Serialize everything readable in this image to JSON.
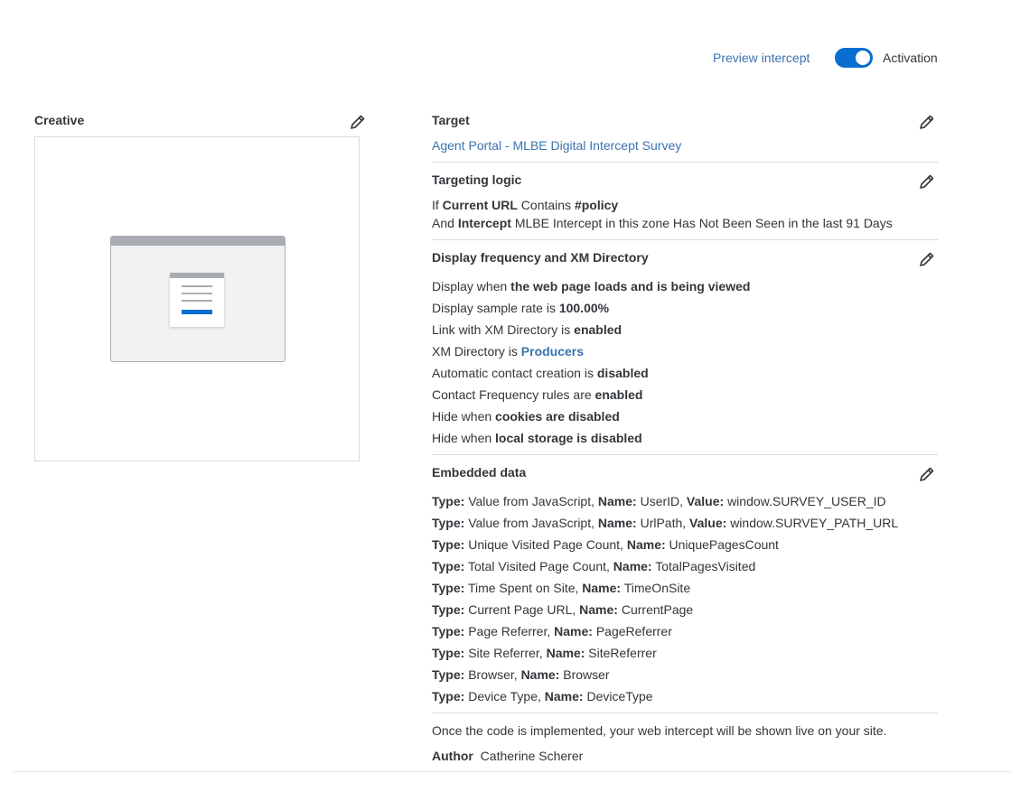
{
  "header": {
    "preview_label": "Preview intercept",
    "activation_label": "Activation",
    "activation_on": true,
    "accent_color": "#0a6ed1"
  },
  "creative": {
    "title": "Creative",
    "edit_icon": "pencil-icon"
  },
  "target": {
    "title": "Target",
    "link_text": "Agent Portal - MLBE Digital Intercept Survey"
  },
  "targeting_logic": {
    "title": "Targeting logic",
    "line1": {
      "prefix": "If",
      "field": "Current URL",
      "operator": "Contains",
      "value": "#policy"
    },
    "line2": {
      "prefix": "And",
      "field": "Intercept",
      "rest": "MLBE Intercept in this zone Has Not Been Seen in the last 91 Days"
    }
  },
  "display": {
    "title": "Display frequency and XM Directory",
    "rows": [
      {
        "text": "Display when",
        "bold": "the web page loads and is being viewed"
      },
      {
        "text": "Display sample rate is",
        "bold": "100.00%"
      },
      {
        "text": "Link with XM Directory is",
        "bold": "enabled"
      },
      {
        "text": "XM Directory is",
        "bold": "Producers"
      },
      {
        "text": "Automatic contact creation is",
        "bold": "disabled"
      },
      {
        "text": "Contact Frequency rules are",
        "bold": "enabled"
      },
      {
        "text": "Hide when",
        "bold": "cookies are disabled"
      },
      {
        "text": "Hide when",
        "bold": "local storage is disabled"
      }
    ]
  },
  "embedded": {
    "title": "Embedded data",
    "type_label": "Type:",
    "name_label": "Name:",
    "value_label": "Value:",
    "rows": [
      {
        "type": "Value from JavaScript,",
        "name": "UserID,",
        "value": "window.SURVEY_USER_ID"
      },
      {
        "type": "Value from JavaScript,",
        "name": "UrlPath,",
        "value": "window.SURVEY_PATH_URL"
      },
      {
        "type": "Unique Visited Page Count,",
        "name": "UniquePagesCount"
      },
      {
        "type": "Total Visited Page Count,",
        "name": "TotalPagesVisited"
      },
      {
        "type": "Time Spent on Site,",
        "name": "TimeOnSite"
      },
      {
        "type": "Current Page URL,",
        "name": "CurrentPage"
      },
      {
        "type": "Page Referrer,",
        "name": "PageReferrer"
      },
      {
        "type": "Site Referrer,",
        "name": "SiteReferrer"
      },
      {
        "type": "Browser,",
        "name": "Browser"
      },
      {
        "type": "Device Type,",
        "name": "DeviceType"
      }
    ]
  },
  "footer": {
    "note": "Once the code is implemented, your web intercept will be shown live on your site.",
    "author_label": "Author",
    "author_name": "Catherine Scherer"
  }
}
